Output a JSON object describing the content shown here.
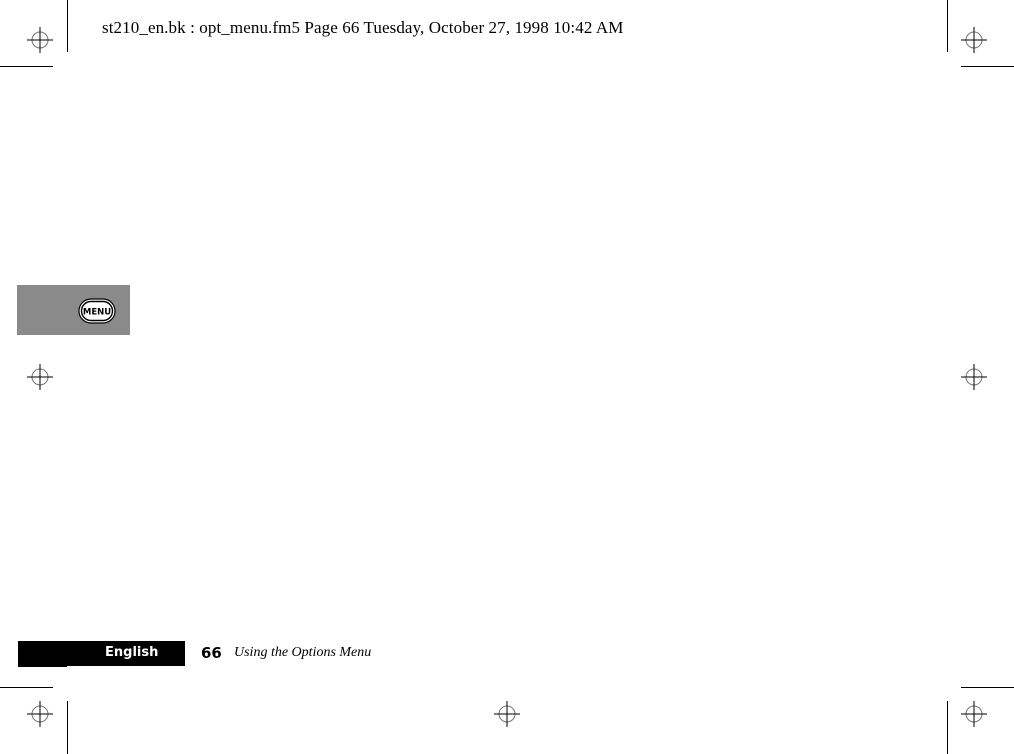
{
  "header": {
    "print_slug": "st210_en.bk : opt_menu.fm5  Page 66  Tuesday, October 27, 1998  10:42 AM"
  },
  "side_tab": {
    "key_label": "MENU",
    "icon": "menu-key-icon"
  },
  "footer": {
    "language": "English",
    "page_number": "66",
    "section_title": "Using the Options Menu"
  },
  "colors": {
    "side_tab_gray": "#8a8a8a",
    "language_bar": "#000000",
    "ink": "#000000"
  }
}
